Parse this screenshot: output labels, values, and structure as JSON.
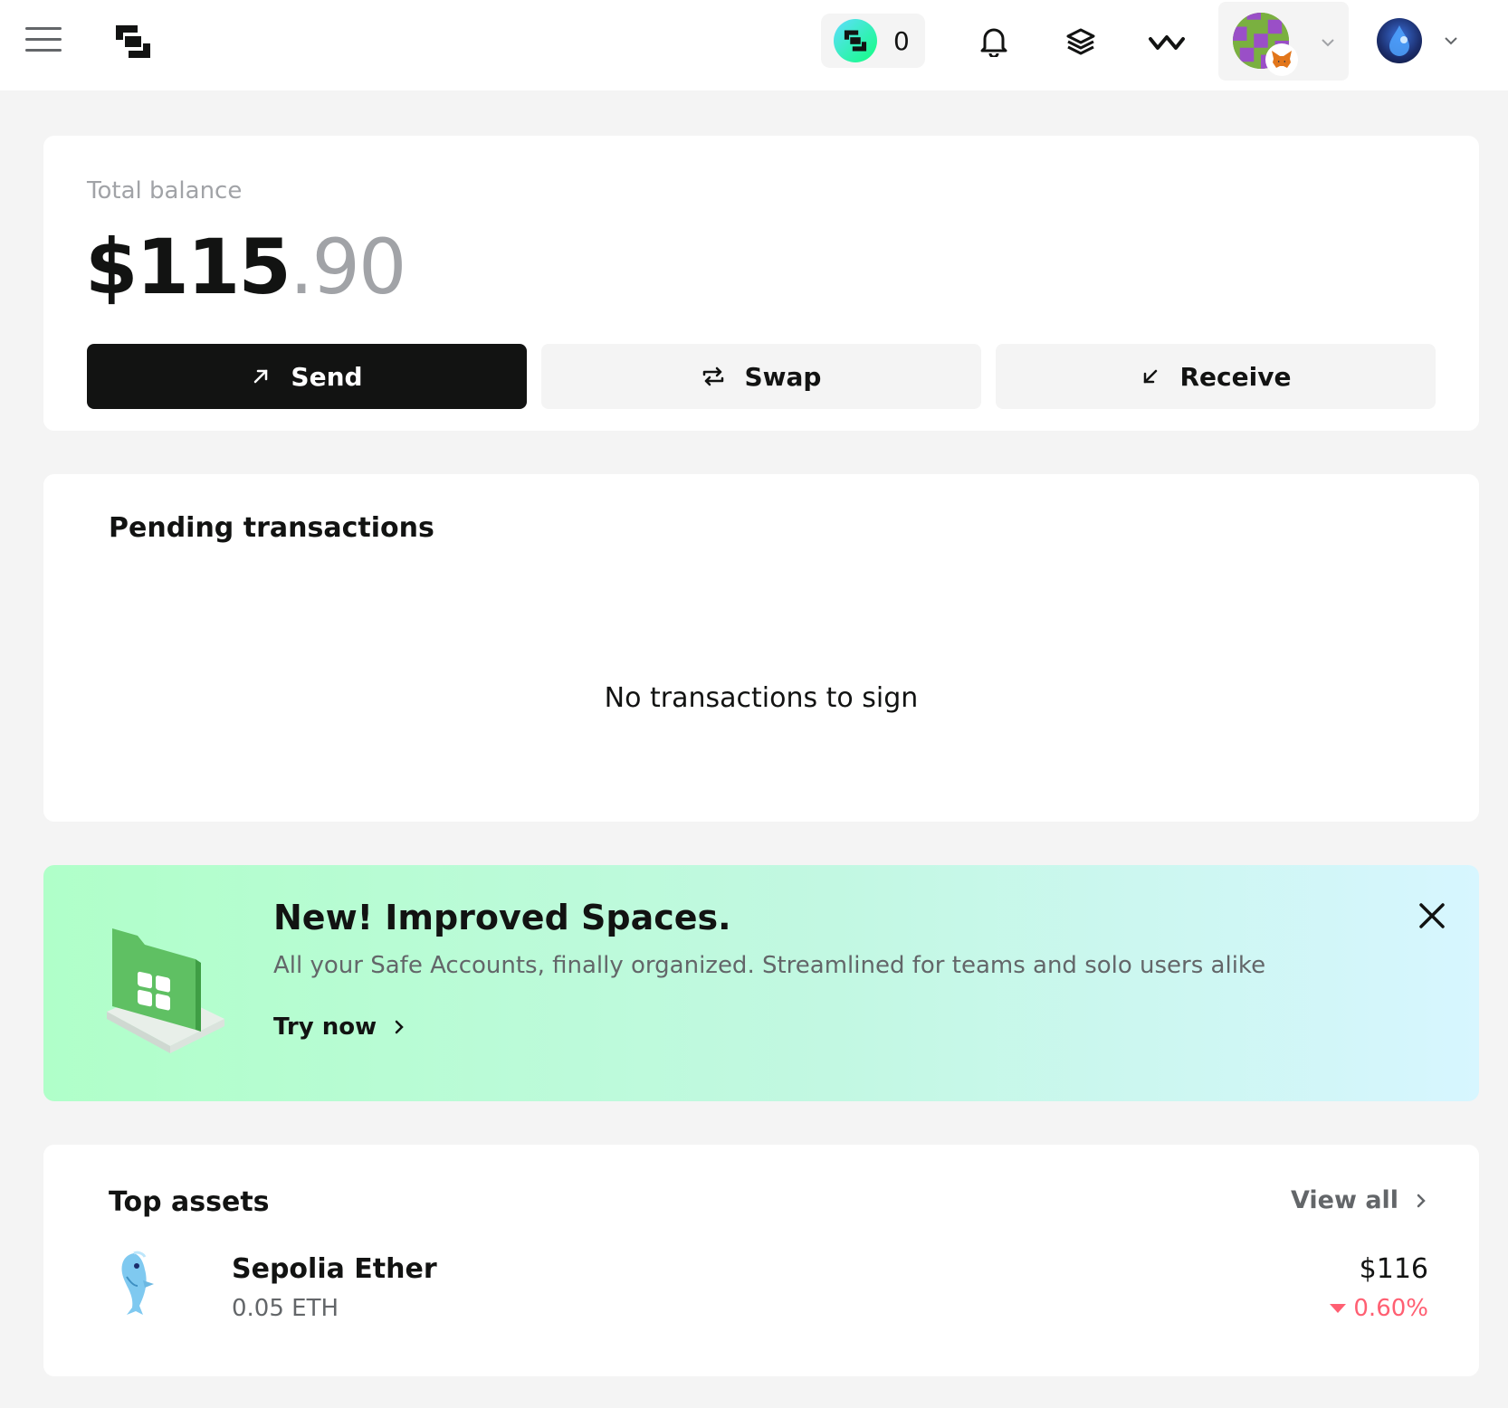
{
  "header": {
    "points_count": "0"
  },
  "balance": {
    "label": "Total balance",
    "amount_whole": "$115",
    "amount_decimal": ".90"
  },
  "actions": {
    "send_label": "Send",
    "swap_label": "Swap",
    "receive_label": "Receive"
  },
  "pending": {
    "title": "Pending transactions",
    "empty_message": "No transactions to sign"
  },
  "banner": {
    "title": "New! Improved Spaces.",
    "subtitle": "All your Safe Accounts, finally organized. Streamlined for teams and solo users alike",
    "cta_label": "Try now"
  },
  "assets": {
    "title": "Top assets",
    "view_all_label": "View all",
    "items": [
      {
        "name": "Sepolia Ether",
        "amount": "0.05 ETH",
        "value": "$116",
        "change": "0.60%",
        "change_direction": "down"
      }
    ]
  },
  "colors": {
    "primary_dark": "#121312",
    "muted_text": "#a1a3a7",
    "secondary_text": "#636669",
    "negative": "#ff5f72",
    "banner_gradient_start": "#b0ffc9",
    "banner_gradient_end": "#d7f6ff"
  }
}
